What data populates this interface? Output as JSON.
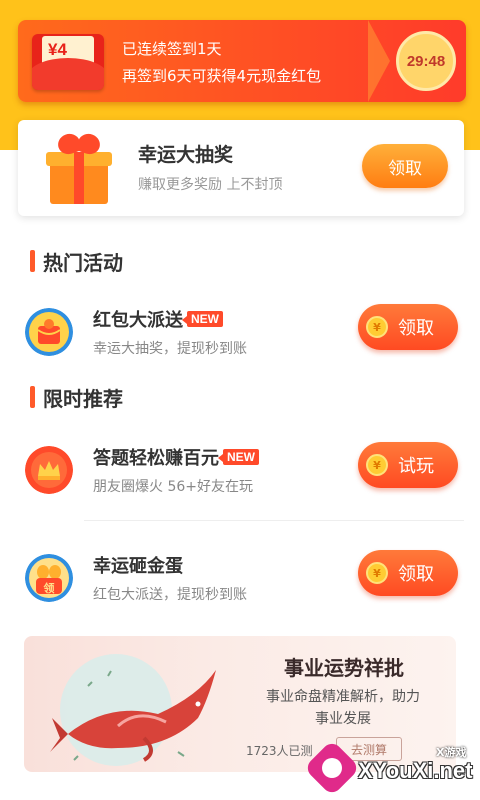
{
  "checkin": {
    "amount": "¥4",
    "line1": "已连续签到1天",
    "line2": "再签到6天可获得4元现金红包",
    "timer": "29:48"
  },
  "lottery": {
    "title": "幸运大抽奖",
    "subtitle": "赚取更多奖励 上不封顶",
    "button": "领取"
  },
  "hot_activities": {
    "title": "热门活动",
    "items": [
      {
        "name": "红包大派送",
        "badge": "NEW",
        "desc": "幸运大抽奖，提现秒到账",
        "button": "领取",
        "coin": "¥"
      }
    ]
  },
  "limited": {
    "title": "限时推荐",
    "items": [
      {
        "name": "答题轻松赚百元",
        "badge": "NEW",
        "desc": "朋友圈爆火 56+好友在玩",
        "button": "试玩",
        "coin": "¥"
      },
      {
        "name": "幸运砸金蛋",
        "icon_label": "领",
        "desc": "红包大派送，提现秒到账",
        "button": "领取",
        "coin": "¥"
      }
    ]
  },
  "promo": {
    "title": "事业运势祥批",
    "desc_line1": "事业命盘精准解析，助力",
    "desc_line2": "事业发展",
    "count": "1723人已测",
    "button": "去测算"
  },
  "watermark": {
    "small": "X游戏",
    "text": "XYouXi.net"
  },
  "colors": {
    "top_band": "#ffc21a",
    "accent_orange": "#ff4a22",
    "badge_red": "#ff4a2a"
  }
}
